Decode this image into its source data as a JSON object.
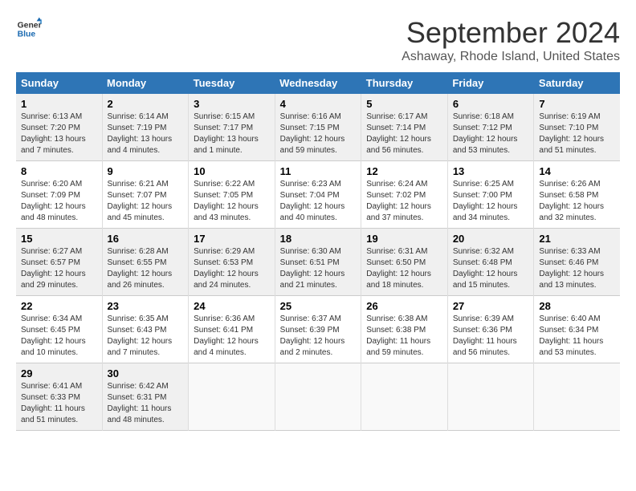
{
  "logo": {
    "line1": "General",
    "line2": "Blue"
  },
  "title": "September 2024",
  "subtitle": "Ashaway, Rhode Island, United States",
  "days_header": [
    "Sunday",
    "Monday",
    "Tuesday",
    "Wednesday",
    "Thursday",
    "Friday",
    "Saturday"
  ],
  "weeks": [
    [
      {
        "day": "1",
        "sunrise": "6:13 AM",
        "sunset": "7:20 PM",
        "daylight": "13 hours and 7 minutes."
      },
      {
        "day": "2",
        "sunrise": "6:14 AM",
        "sunset": "7:19 PM",
        "daylight": "13 hours and 4 minutes."
      },
      {
        "day": "3",
        "sunrise": "6:15 AM",
        "sunset": "7:17 PM",
        "daylight": "13 hours and 1 minute."
      },
      {
        "day": "4",
        "sunrise": "6:16 AM",
        "sunset": "7:15 PM",
        "daylight": "12 hours and 59 minutes."
      },
      {
        "day": "5",
        "sunrise": "6:17 AM",
        "sunset": "7:14 PM",
        "daylight": "12 hours and 56 minutes."
      },
      {
        "day": "6",
        "sunrise": "6:18 AM",
        "sunset": "7:12 PM",
        "daylight": "12 hours and 53 minutes."
      },
      {
        "day": "7",
        "sunrise": "6:19 AM",
        "sunset": "7:10 PM",
        "daylight": "12 hours and 51 minutes."
      }
    ],
    [
      {
        "day": "8",
        "sunrise": "6:20 AM",
        "sunset": "7:09 PM",
        "daylight": "12 hours and 48 minutes."
      },
      {
        "day": "9",
        "sunrise": "6:21 AM",
        "sunset": "7:07 PM",
        "daylight": "12 hours and 45 minutes."
      },
      {
        "day": "10",
        "sunrise": "6:22 AM",
        "sunset": "7:05 PM",
        "daylight": "12 hours and 43 minutes."
      },
      {
        "day": "11",
        "sunrise": "6:23 AM",
        "sunset": "7:04 PM",
        "daylight": "12 hours and 40 minutes."
      },
      {
        "day": "12",
        "sunrise": "6:24 AM",
        "sunset": "7:02 PM",
        "daylight": "12 hours and 37 minutes."
      },
      {
        "day": "13",
        "sunrise": "6:25 AM",
        "sunset": "7:00 PM",
        "daylight": "12 hours and 34 minutes."
      },
      {
        "day": "14",
        "sunrise": "6:26 AM",
        "sunset": "6:58 PM",
        "daylight": "12 hours and 32 minutes."
      }
    ],
    [
      {
        "day": "15",
        "sunrise": "6:27 AM",
        "sunset": "6:57 PM",
        "daylight": "12 hours and 29 minutes."
      },
      {
        "day": "16",
        "sunrise": "6:28 AM",
        "sunset": "6:55 PM",
        "daylight": "12 hours and 26 minutes."
      },
      {
        "day": "17",
        "sunrise": "6:29 AM",
        "sunset": "6:53 PM",
        "daylight": "12 hours and 24 minutes."
      },
      {
        "day": "18",
        "sunrise": "6:30 AM",
        "sunset": "6:51 PM",
        "daylight": "12 hours and 21 minutes."
      },
      {
        "day": "19",
        "sunrise": "6:31 AM",
        "sunset": "6:50 PM",
        "daylight": "12 hours and 18 minutes."
      },
      {
        "day": "20",
        "sunrise": "6:32 AM",
        "sunset": "6:48 PM",
        "daylight": "12 hours and 15 minutes."
      },
      {
        "day": "21",
        "sunrise": "6:33 AM",
        "sunset": "6:46 PM",
        "daylight": "12 hours and 13 minutes."
      }
    ],
    [
      {
        "day": "22",
        "sunrise": "6:34 AM",
        "sunset": "6:45 PM",
        "daylight": "12 hours and 10 minutes."
      },
      {
        "day": "23",
        "sunrise": "6:35 AM",
        "sunset": "6:43 PM",
        "daylight": "12 hours and 7 minutes."
      },
      {
        "day": "24",
        "sunrise": "6:36 AM",
        "sunset": "6:41 PM",
        "daylight": "12 hours and 4 minutes."
      },
      {
        "day": "25",
        "sunrise": "6:37 AM",
        "sunset": "6:39 PM",
        "daylight": "12 hours and 2 minutes."
      },
      {
        "day": "26",
        "sunrise": "6:38 AM",
        "sunset": "6:38 PM",
        "daylight": "11 hours and 59 minutes."
      },
      {
        "day": "27",
        "sunrise": "6:39 AM",
        "sunset": "6:36 PM",
        "daylight": "11 hours and 56 minutes."
      },
      {
        "day": "28",
        "sunrise": "6:40 AM",
        "sunset": "6:34 PM",
        "daylight": "11 hours and 53 minutes."
      }
    ],
    [
      {
        "day": "29",
        "sunrise": "6:41 AM",
        "sunset": "6:33 PM",
        "daylight": "11 hours and 51 minutes."
      },
      {
        "day": "30",
        "sunrise": "6:42 AM",
        "sunset": "6:31 PM",
        "daylight": "11 hours and 48 minutes."
      },
      null,
      null,
      null,
      null,
      null
    ]
  ],
  "labels": {
    "sunrise": "Sunrise:",
    "sunset": "Sunset:",
    "daylight": "Daylight hours"
  }
}
